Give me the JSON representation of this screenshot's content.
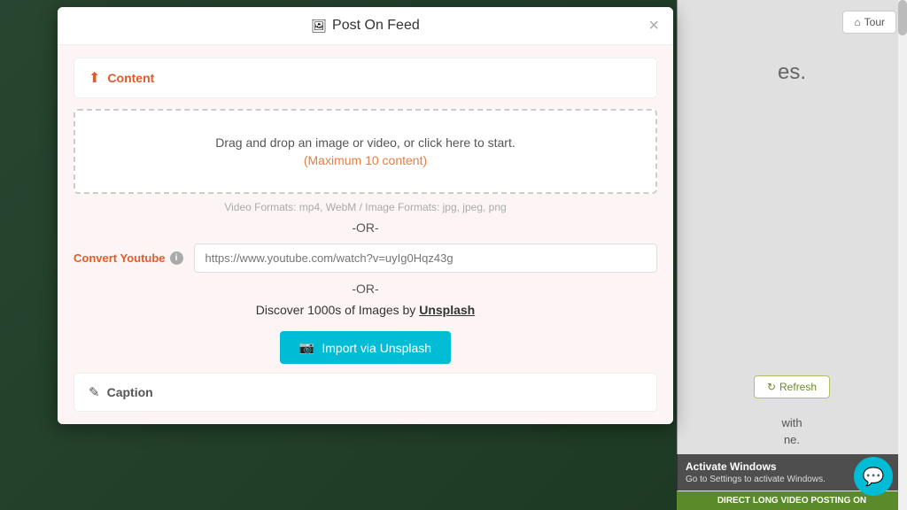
{
  "modal": {
    "title": "Post On Feed",
    "close_label": "×",
    "title_icon": "📷"
  },
  "content_section": {
    "label": "Content",
    "upload_icon": "⬆"
  },
  "dropzone": {
    "main_text": "Drag and drop an image or video, or click here to start.",
    "sub_text": "(Maximum 10 content)"
  },
  "formats": {
    "text": "Video Formats: mp4, WebM / Image Formats: jpg, jpeg, png"
  },
  "or_divider_1": "-OR-",
  "convert_youtube": {
    "label": "Convert Youtube",
    "info": "i",
    "placeholder": "https://www.youtube.com/watch?v=uyIg0Hqz43g"
  },
  "or_divider_2": "-OR-",
  "unsplash": {
    "text_before": "Discover 1000s of Images by ",
    "link_text": "Unsplash",
    "button_label": "Import via Unsplash",
    "camera_icon": "📷"
  },
  "caption_section": {
    "label": "Caption",
    "edit_icon": "✎"
  },
  "sidebar": {
    "tour_button": "Tour",
    "tour_icon": "⌂",
    "refresh_button": "Refresh",
    "refresh_icon": "↻",
    "sidebar_text_1": "es.",
    "sidebar_text_2": "with",
    "sidebar_text_3": "ne."
  },
  "activate_windows": {
    "title": "Activate Windows",
    "subtitle": "Go to Settings to activate Windows."
  },
  "bottom_bar_text": "DIRECT LONG VIDEO POSTING ON",
  "chat_icon": "💬"
}
